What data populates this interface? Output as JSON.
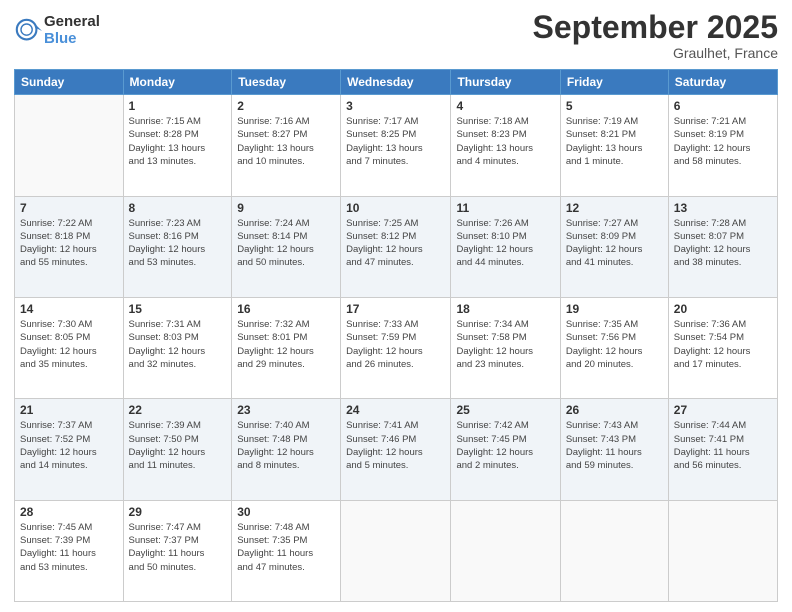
{
  "logo": {
    "general": "General",
    "blue": "Blue"
  },
  "title": "September 2025",
  "location": "Graulhet, France",
  "days_header": [
    "Sunday",
    "Monday",
    "Tuesday",
    "Wednesday",
    "Thursday",
    "Friday",
    "Saturday"
  ],
  "weeks": [
    [
      {
        "num": "",
        "info": ""
      },
      {
        "num": "1",
        "info": "Sunrise: 7:15 AM\nSunset: 8:28 PM\nDaylight: 13 hours\nand 13 minutes."
      },
      {
        "num": "2",
        "info": "Sunrise: 7:16 AM\nSunset: 8:27 PM\nDaylight: 13 hours\nand 10 minutes."
      },
      {
        "num": "3",
        "info": "Sunrise: 7:17 AM\nSunset: 8:25 PM\nDaylight: 13 hours\nand 7 minutes."
      },
      {
        "num": "4",
        "info": "Sunrise: 7:18 AM\nSunset: 8:23 PM\nDaylight: 13 hours\nand 4 minutes."
      },
      {
        "num": "5",
        "info": "Sunrise: 7:19 AM\nSunset: 8:21 PM\nDaylight: 13 hours\nand 1 minute."
      },
      {
        "num": "6",
        "info": "Sunrise: 7:21 AM\nSunset: 8:19 PM\nDaylight: 12 hours\nand 58 minutes."
      }
    ],
    [
      {
        "num": "7",
        "info": "Sunrise: 7:22 AM\nSunset: 8:18 PM\nDaylight: 12 hours\nand 55 minutes."
      },
      {
        "num": "8",
        "info": "Sunrise: 7:23 AM\nSunset: 8:16 PM\nDaylight: 12 hours\nand 53 minutes."
      },
      {
        "num": "9",
        "info": "Sunrise: 7:24 AM\nSunset: 8:14 PM\nDaylight: 12 hours\nand 50 minutes."
      },
      {
        "num": "10",
        "info": "Sunrise: 7:25 AM\nSunset: 8:12 PM\nDaylight: 12 hours\nand 47 minutes."
      },
      {
        "num": "11",
        "info": "Sunrise: 7:26 AM\nSunset: 8:10 PM\nDaylight: 12 hours\nand 44 minutes."
      },
      {
        "num": "12",
        "info": "Sunrise: 7:27 AM\nSunset: 8:09 PM\nDaylight: 12 hours\nand 41 minutes."
      },
      {
        "num": "13",
        "info": "Sunrise: 7:28 AM\nSunset: 8:07 PM\nDaylight: 12 hours\nand 38 minutes."
      }
    ],
    [
      {
        "num": "14",
        "info": "Sunrise: 7:30 AM\nSunset: 8:05 PM\nDaylight: 12 hours\nand 35 minutes."
      },
      {
        "num": "15",
        "info": "Sunrise: 7:31 AM\nSunset: 8:03 PM\nDaylight: 12 hours\nand 32 minutes."
      },
      {
        "num": "16",
        "info": "Sunrise: 7:32 AM\nSunset: 8:01 PM\nDaylight: 12 hours\nand 29 minutes."
      },
      {
        "num": "17",
        "info": "Sunrise: 7:33 AM\nSunset: 7:59 PM\nDaylight: 12 hours\nand 26 minutes."
      },
      {
        "num": "18",
        "info": "Sunrise: 7:34 AM\nSunset: 7:58 PM\nDaylight: 12 hours\nand 23 minutes."
      },
      {
        "num": "19",
        "info": "Sunrise: 7:35 AM\nSunset: 7:56 PM\nDaylight: 12 hours\nand 20 minutes."
      },
      {
        "num": "20",
        "info": "Sunrise: 7:36 AM\nSunset: 7:54 PM\nDaylight: 12 hours\nand 17 minutes."
      }
    ],
    [
      {
        "num": "21",
        "info": "Sunrise: 7:37 AM\nSunset: 7:52 PM\nDaylight: 12 hours\nand 14 minutes."
      },
      {
        "num": "22",
        "info": "Sunrise: 7:39 AM\nSunset: 7:50 PM\nDaylight: 12 hours\nand 11 minutes."
      },
      {
        "num": "23",
        "info": "Sunrise: 7:40 AM\nSunset: 7:48 PM\nDaylight: 12 hours\nand 8 minutes."
      },
      {
        "num": "24",
        "info": "Sunrise: 7:41 AM\nSunset: 7:46 PM\nDaylight: 12 hours\nand 5 minutes."
      },
      {
        "num": "25",
        "info": "Sunrise: 7:42 AM\nSunset: 7:45 PM\nDaylight: 12 hours\nand 2 minutes."
      },
      {
        "num": "26",
        "info": "Sunrise: 7:43 AM\nSunset: 7:43 PM\nDaylight: 11 hours\nand 59 minutes."
      },
      {
        "num": "27",
        "info": "Sunrise: 7:44 AM\nSunset: 7:41 PM\nDaylight: 11 hours\nand 56 minutes."
      }
    ],
    [
      {
        "num": "28",
        "info": "Sunrise: 7:45 AM\nSunset: 7:39 PM\nDaylight: 11 hours\nand 53 minutes."
      },
      {
        "num": "29",
        "info": "Sunrise: 7:47 AM\nSunset: 7:37 PM\nDaylight: 11 hours\nand 50 minutes."
      },
      {
        "num": "30",
        "info": "Sunrise: 7:48 AM\nSunset: 7:35 PM\nDaylight: 11 hours\nand 47 minutes."
      },
      {
        "num": "",
        "info": ""
      },
      {
        "num": "",
        "info": ""
      },
      {
        "num": "",
        "info": ""
      },
      {
        "num": "",
        "info": ""
      }
    ]
  ]
}
